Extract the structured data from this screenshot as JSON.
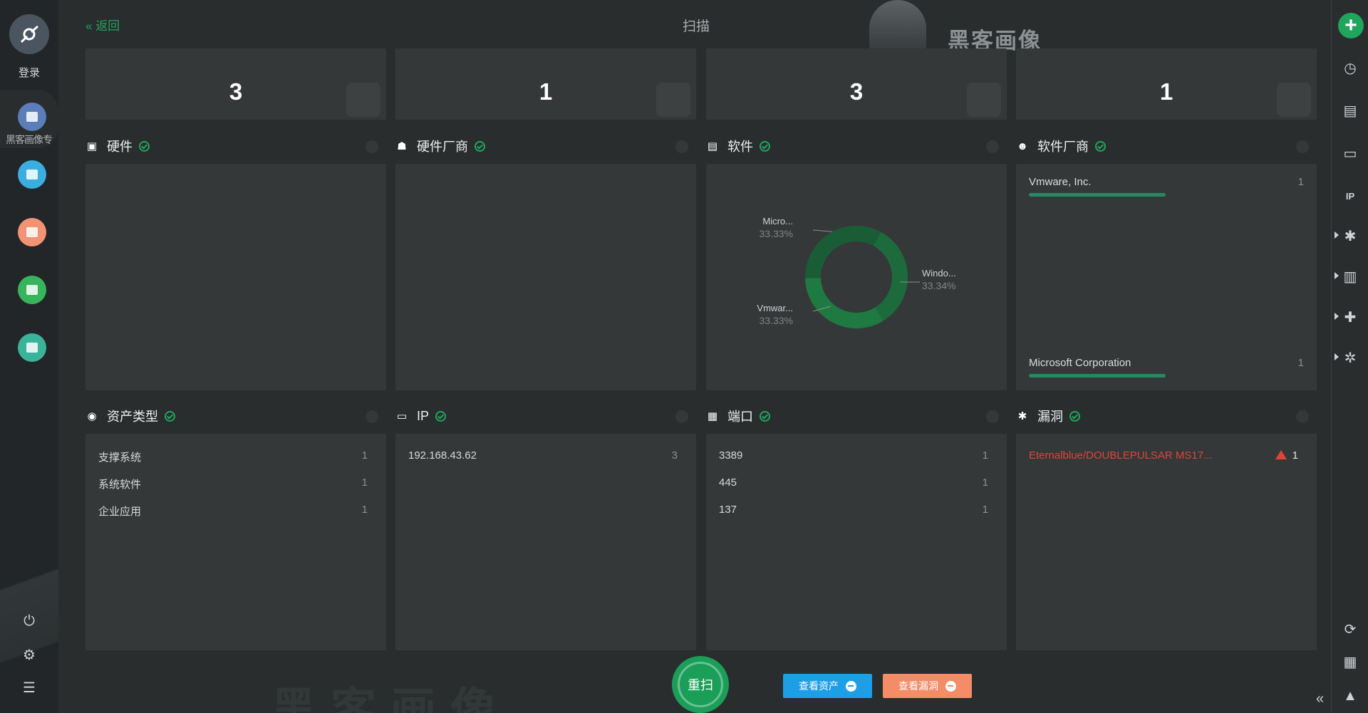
{
  "app": {
    "title": "扫描",
    "back_label": "返回",
    "watermark": "黑客画像",
    "footer_watermark": "黑客画像"
  },
  "left_sidebar": {
    "login_label": "登录",
    "active_label": "黑客画像专",
    "items": [
      {
        "icon": "server-icon",
        "color": "#5b7db8"
      },
      {
        "icon": "database-icon",
        "color": "#3aaee0"
      },
      {
        "icon": "bug-icon",
        "color": "#f39373"
      },
      {
        "icon": "chart-line-icon",
        "color": "#37b55d"
      },
      {
        "icon": "puzzle-icon",
        "color": "#3bb39a"
      }
    ],
    "bottom": [
      "power-icon",
      "settings-icon",
      "menu-icon"
    ]
  },
  "right_sidebar": {
    "items": [
      "add-icon",
      "clock-icon",
      "document-icon",
      "monitor-icon",
      "ip-icon",
      "bug-icon",
      "bar-chart-icon",
      "puzzle-icon",
      "puzzle-gear-icon",
      "refresh-icon",
      "report-icon",
      "warning-icon",
      "collapse-icon"
    ]
  },
  "stats": [
    {
      "value": "3"
    },
    {
      "value": "1"
    },
    {
      "value": "3"
    },
    {
      "value": "1"
    }
  ],
  "panels": {
    "hardware": {
      "title": "硬件"
    },
    "hardware_vendor": {
      "title": "硬件厂商"
    },
    "software": {
      "title": "软件",
      "chart_data": {
        "type": "pie",
        "categories": [
          "Micro...",
          "Windo...",
          "Vmwar..."
        ],
        "values": [
          33.33,
          33.34,
          33.33
        ],
        "labels": [
          "33.33%",
          "33.34%",
          "33.33%"
        ]
      }
    },
    "software_vendor": {
      "title": "软件厂商",
      "rows": [
        {
          "name": "Vmware, Inc.",
          "count": "1",
          "fraction": 1
        },
        {
          "name": "Microsoft Corporation",
          "count": "1",
          "fraction": 1
        }
      ]
    },
    "asset_type": {
      "title": "资产类型",
      "rows": [
        {
          "label": "支撑系统",
          "count": "1"
        },
        {
          "label": "系统软件",
          "count": "1"
        },
        {
          "label": "企业应用",
          "count": "1"
        }
      ]
    },
    "ip": {
      "title": "IP",
      "rows": [
        {
          "label": "192.168.43.62",
          "count": "3"
        }
      ]
    },
    "port": {
      "title": "端口",
      "rows": [
        {
          "label": "3389",
          "count": "1"
        },
        {
          "label": "445",
          "count": "1"
        },
        {
          "label": "137",
          "count": "1"
        }
      ]
    },
    "vuln": {
      "title": "漏洞",
      "rows": [
        {
          "label": "Eternalblue/DOUBLEPULSAR MS17...",
          "count": "1"
        }
      ]
    }
  },
  "actions": {
    "rescan": "重扫",
    "view_assets": "查看资产",
    "view_vulns": "查看漏洞"
  },
  "colors": {
    "accent": "#1fa55c",
    "danger": "#e0433a",
    "assets_button": "#1c9fe6",
    "vulns_button": "#f38c67",
    "chart_green": "#1f7a42"
  }
}
